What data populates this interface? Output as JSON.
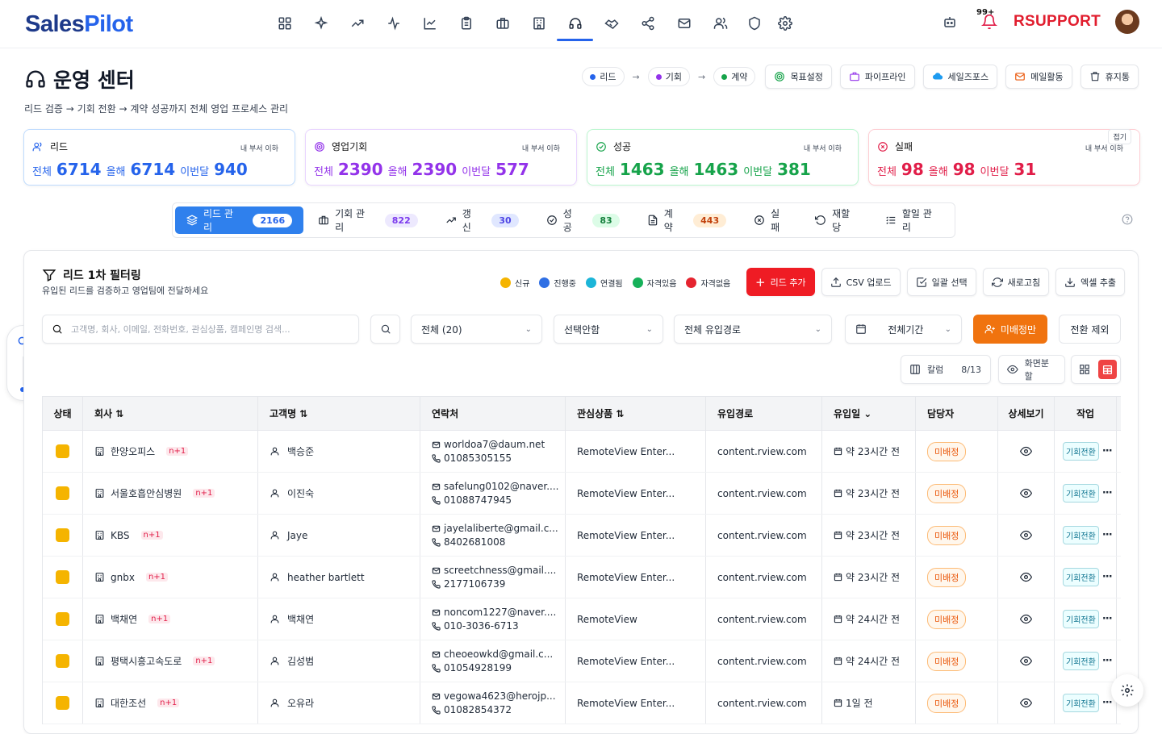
{
  "logo": {
    "text_a": "Sales",
    "text_b": "Pilot"
  },
  "topnav": {
    "notif_count": "99+",
    "brand": "RSUPPORT"
  },
  "page": {
    "title": "운영 센터",
    "subtitle": "리드 검증 → 기회 전환 → 계약 성공까지 전체 영업 프로세스 관리"
  },
  "flow": {
    "step1": "리드",
    "step2": "기회",
    "step3": "계약",
    "arrow": "→"
  },
  "header_buttons": {
    "goal": "목표설정",
    "pipeline": "파이프라인",
    "salesforce": "세일즈포스",
    "mail": "메일활동",
    "trash": "휴지통"
  },
  "stats": [
    {
      "label": "리드",
      "scope": "내 부서 이하",
      "total_label": "전체",
      "total": "6714",
      "year_label": "올해",
      "year": "6714",
      "month_label": "이번달",
      "month": "940",
      "color": "#2563eb"
    },
    {
      "label": "영업기회",
      "scope": "내 부서 이하",
      "total_label": "전체",
      "total": "2390",
      "year_label": "올해",
      "year": "2390",
      "month_label": "이번달",
      "month": "577",
      "color": "#9333ea"
    },
    {
      "label": "성공",
      "scope": "내 부서 이하",
      "total_label": "전체",
      "total": "1463",
      "year_label": "올해",
      "year": "1463",
      "month_label": "이번달",
      "month": "381",
      "color": "#16a34a"
    },
    {
      "label": "실패",
      "scope": "내 부서 이하",
      "total_label": "전체",
      "total": "98",
      "year_label": "올해",
      "year": "98",
      "month_label": "이번달",
      "month": "31",
      "color": "#e11d48"
    }
  ],
  "fold_label": "접기",
  "tabs": [
    {
      "label": "리드 관리",
      "count": "2166"
    },
    {
      "label": "기회 관리",
      "count": "822"
    },
    {
      "label": "갱신",
      "count": "30"
    },
    {
      "label": "성공",
      "count": "83"
    },
    {
      "label": "계약",
      "count": "443"
    },
    {
      "label": "실패",
      "count": ""
    },
    {
      "label": "재할당",
      "count": ""
    },
    {
      "label": "할일 관리",
      "count": ""
    }
  ],
  "filter": {
    "title": "리드 1차 필터링",
    "subtitle": "유입된 리드를 검증하고 영업팀에 전달하세요",
    "legend": [
      {
        "label": "신규",
        "color": "#f5b400"
      },
      {
        "label": "진행중",
        "color": "#2f6fe4"
      },
      {
        "label": "연결됨",
        "color": "#1cb5d8"
      },
      {
        "label": "자격있음",
        "color": "#16b15a"
      },
      {
        "label": "자격없음",
        "color": "#e5242f"
      }
    ],
    "add_lead": "리드 추가",
    "csv_upload": "CSV 업로드",
    "bulk_select": "일괄 선택",
    "refresh": "새로고침",
    "excel": "엑셀 추출",
    "search_placeholder": "고객명, 회사, 이메일, 전화번호, 관심상품, 캠페인명 검색...",
    "select_all": "전체 (20)",
    "select_none": "선택안함",
    "select_source": "전체 유입경로",
    "select_period": "전체기간",
    "unassigned_only": "미배정만",
    "exclude_all": "전환 제외",
    "column_label": "칼럼",
    "column_count": "8/13",
    "split_view": "화면분할"
  },
  "table": {
    "headers": [
      "상태",
      "회사 ⇅",
      "고객명 ⇅",
      "연락처",
      "관심상품 ⇅",
      "유입경로",
      "유입일 ⌄",
      "담당자",
      "상세보기",
      "작업"
    ],
    "rows": [
      {
        "company": "한양오피스",
        "tag": "n+1",
        "name": "백승준",
        "email": "worldoa7@daum.net",
        "phone": "01085305155",
        "product": "RemoteView Enter...",
        "source": "content.rview.com",
        "date": "약 23시간 전",
        "owner": "미배정",
        "action": "기회전환"
      },
      {
        "company": "서울호흡안심병원",
        "tag": "n+1",
        "name": "이진숙",
        "email": "safelung0102@naver....",
        "phone": "01088747945",
        "product": "RemoteView Enter...",
        "source": "content.rview.com",
        "date": "약 23시간 전",
        "owner": "미배정",
        "action": "기회전환"
      },
      {
        "company": "KBS",
        "tag": "n+1",
        "name": "Jaye",
        "email": "jayelaliberte@gmail.c...",
        "phone": "8402681008",
        "product": "RemoteView Enter...",
        "source": "content.rview.com",
        "date": "약 23시간 전",
        "owner": "미배정",
        "action": "기회전환"
      },
      {
        "company": "gnbx",
        "tag": "n+1",
        "name": "heather bartlett",
        "email": "screetchness@gmail....",
        "phone": "2177106739",
        "product": "RemoteView Enter...",
        "source": "content.rview.com",
        "date": "약 23시간 전",
        "owner": "미배정",
        "action": "기회전환"
      },
      {
        "company": "백채연",
        "tag": "n+1",
        "name": "백채연",
        "email": "noncom1227@naver....",
        "phone": "010-3036-6713",
        "product": "RemoteView",
        "source": "content.rview.com",
        "date": "약 24시간 전",
        "owner": "미배정",
        "action": "기회전환"
      },
      {
        "company": "평택시흥고속도로",
        "tag": "n+1",
        "name": "김성범",
        "email": "cheoeowkd@gmail.c...",
        "phone": "01054928199",
        "product": "RemoteView Enter...",
        "source": "content.rview.com",
        "date": "약 24시간 전",
        "owner": "미배정",
        "action": "기회전환"
      },
      {
        "company": "대한조선",
        "tag": "n+1",
        "name": "오유라",
        "email": "vegowa4623@herojp...",
        "phone": "01082854372",
        "product": "RemoteView Enter...",
        "source": "content.rview.com",
        "date": "1일 전",
        "owner": "미배정",
        "action": "기회전환"
      }
    ]
  }
}
